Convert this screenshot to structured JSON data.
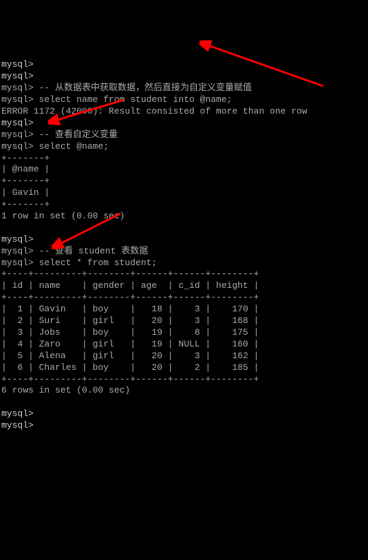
{
  "lines": {
    "p1": "mysql>",
    "p2": "mysql>",
    "c1": "mysql> -- 从数据表中获取数据，然后直接为自定义变量赋值",
    "q1": "mysql> select name from student into @name;",
    "err": "ERROR 1172 (42000): Result consisted of more than one row",
    "p3": "mysql>",
    "c2": "mysql> -- 查看自定义变量",
    "q2": "mysql> select @name;",
    "sep1": "+-------+",
    "hdr1": "| @name |",
    "sep2": "+-------+",
    "row1": "| Gavin |",
    "sep3": "+-------+",
    "res1": "1 row in set (0.00 sec)",
    "p4": "mysql>",
    "c3": "mysql> -- 查看 student 表数据",
    "q3": "mysql> select * from student;",
    "tsep1": "+----+---------+--------+------+------+--------+",
    "thdr": "| id | name    | gender | age  | c_id | height |",
    "tsep2": "+----+---------+--------+------+------+--------+",
    "tr1": "|  1 | Gavin   | boy    |   18 |    3 |    170 |",
    "tr2": "|  2 | Suri    | girl   |   20 |    3 |    168 |",
    "tr3": "|  3 | Jobs    | boy    |   19 |    8 |    175 |",
    "tr4": "|  4 | Zaro    | girl   |   19 | NULL |    160 |",
    "tr5": "|  5 | Alena   | girl   |   20 |    3 |    162 |",
    "tr6": "|  6 | Charles | boy    |   20 |    2 |    185 |",
    "tsep3": "+----+---------+--------+------+------+--------+",
    "res2": "6 rows in set (0.00 sec)",
    "p5": "mysql>",
    "p6": "mysql>"
  },
  "chart_data": {
    "type": "table",
    "title": "student",
    "columns": [
      "id",
      "name",
      "gender",
      "age",
      "c_id",
      "height"
    ],
    "rows": [
      [
        1,
        "Gavin",
        "boy",
        18,
        3,
        170
      ],
      [
        2,
        "Suri",
        "girl",
        20,
        3,
        168
      ],
      [
        3,
        "Jobs",
        "boy",
        19,
        8,
        175
      ],
      [
        4,
        "Zaro",
        "girl",
        19,
        null,
        160
      ],
      [
        5,
        "Alena",
        "girl",
        20,
        3,
        162
      ],
      [
        6,
        "Charles",
        "boy",
        20,
        2,
        185
      ]
    ],
    "var_result": {
      "name": "@name",
      "value": "Gavin"
    }
  }
}
